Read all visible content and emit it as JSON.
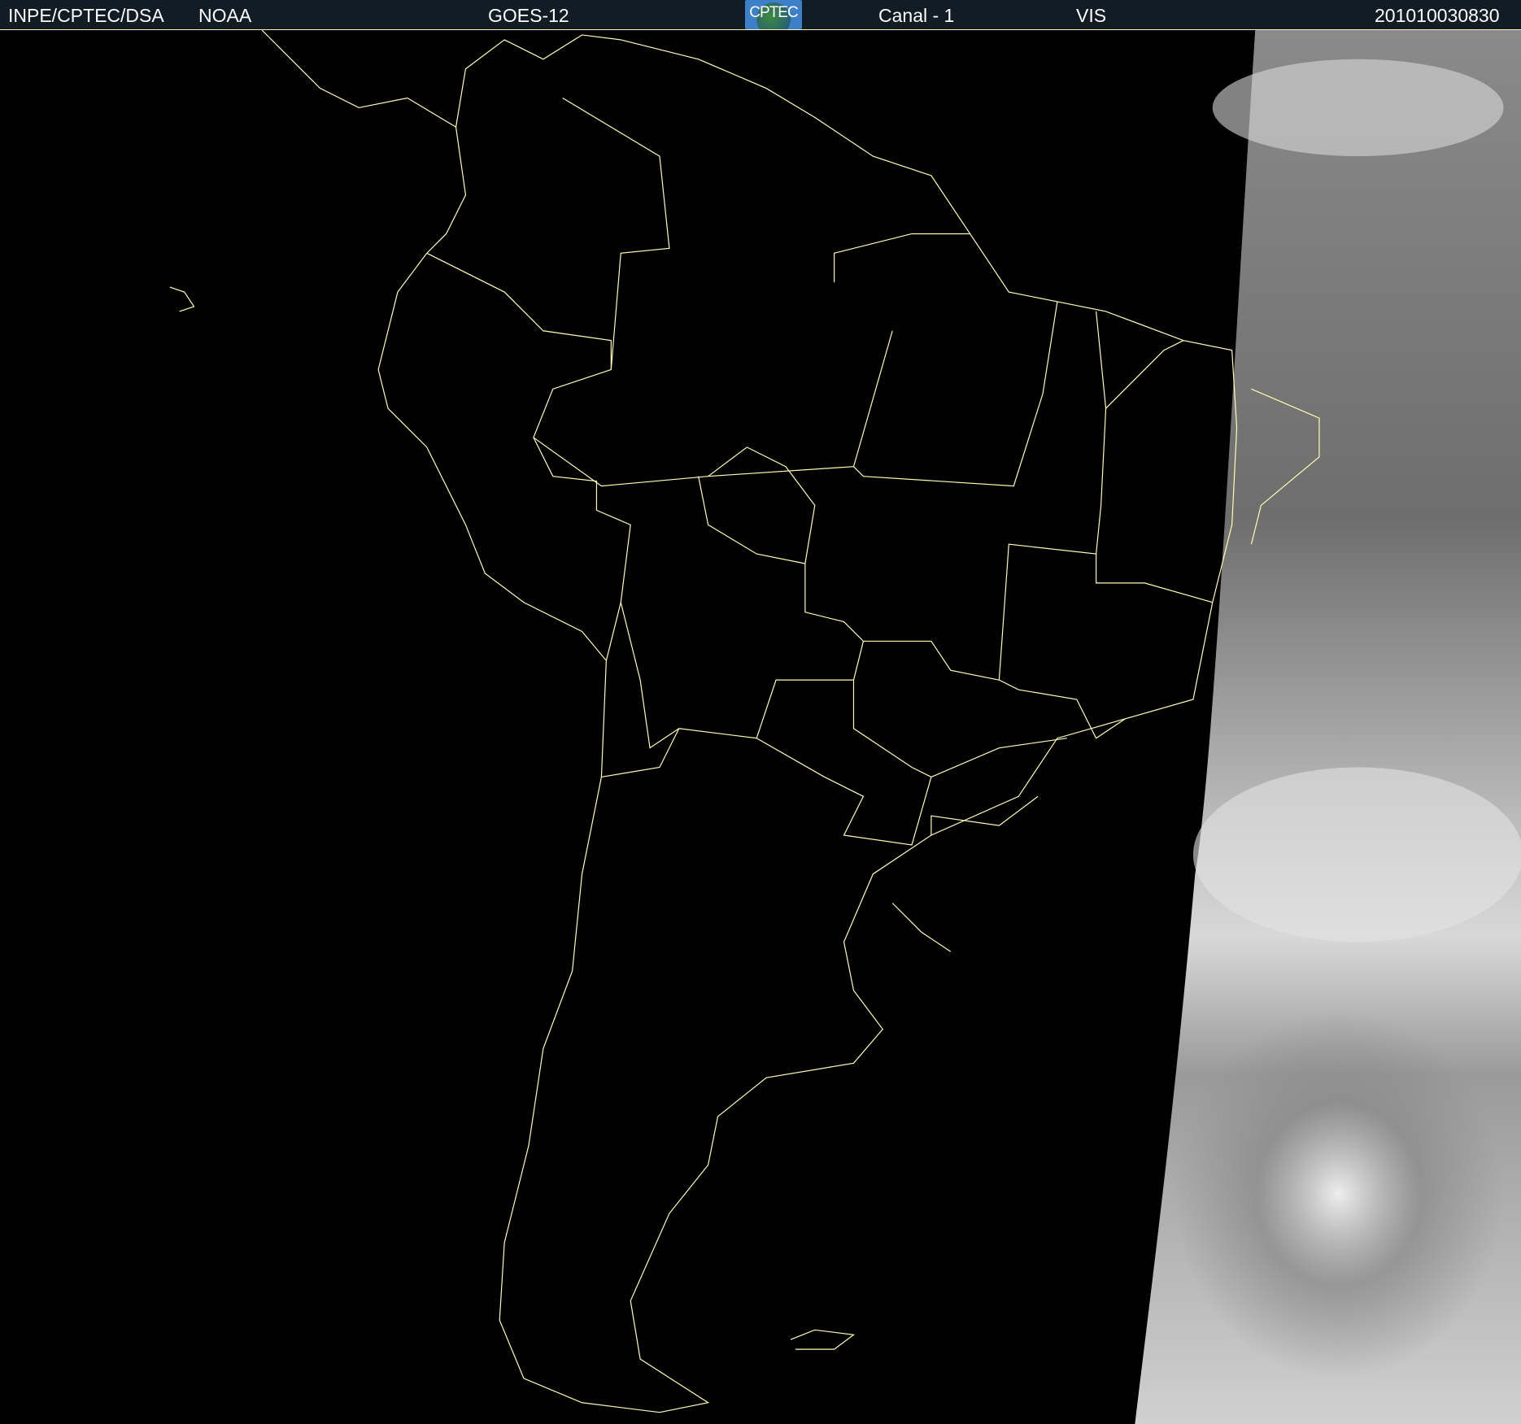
{
  "header": {
    "institution": "INPE/CPTEC/DSA",
    "agency": "NOAA",
    "satellite": "GOES-12",
    "logo_text": "CPTEC",
    "channel": "Canal - 1",
    "band": "VIS",
    "timestamp": "201010030830"
  },
  "colors": {
    "header_bg": "#111c24",
    "borders": "#ffffb0",
    "background": "#000000"
  }
}
